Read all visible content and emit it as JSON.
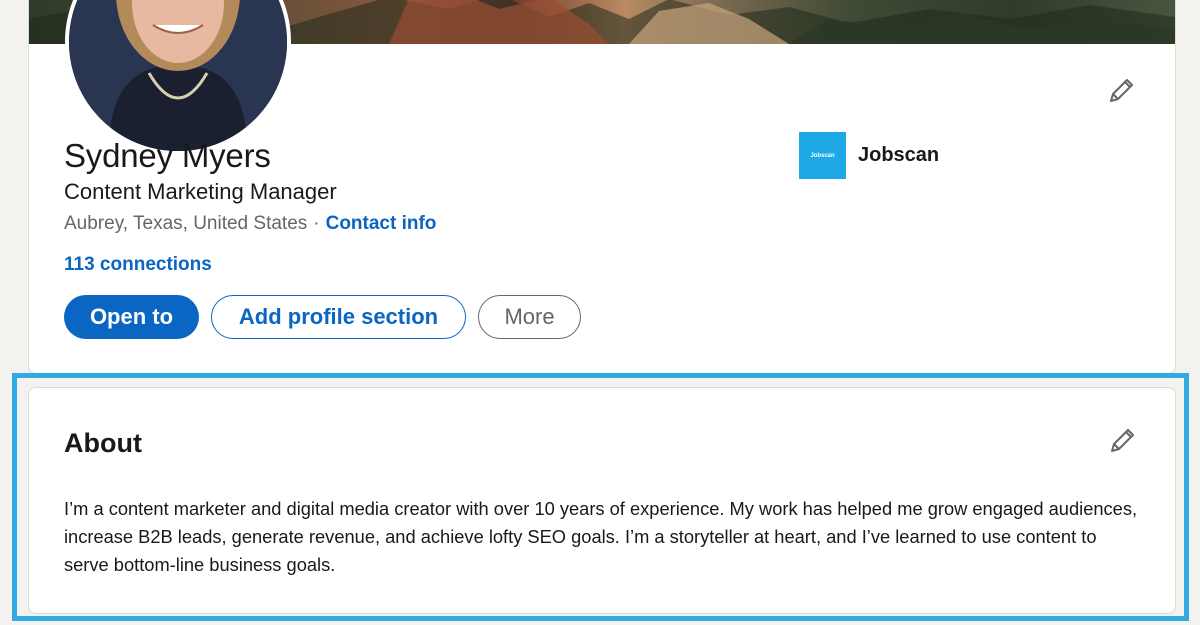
{
  "profile": {
    "name": "Sydney Myers",
    "headline": "Content Marketing Manager",
    "location": "Aubrey, Texas, United States",
    "separator": "·",
    "contact_info": "Contact info",
    "connections": "113 connections",
    "current_company": {
      "name": "Jobscan",
      "logo_text": "Jobscan",
      "logo_color": "#1fa8e6"
    },
    "buttons": {
      "open_to": "Open to",
      "add_section": "Add profile section",
      "more": "More"
    }
  },
  "about": {
    "title": "About",
    "text": "I’m a content marketer and digital media creator with over 10 years of experience. My work has helped me grow engaged audiences, increase B2B leads, generate revenue, and achieve lofty SEO goals. I’m a storyteller at heart, and I’ve learned to use content to serve bottom-line business goals."
  },
  "icons": {
    "edit": "pencil-icon"
  },
  "colors": {
    "accent": "#0a66c2",
    "highlight_border": "#32a9e1",
    "page_background": "#f3f2ef"
  }
}
